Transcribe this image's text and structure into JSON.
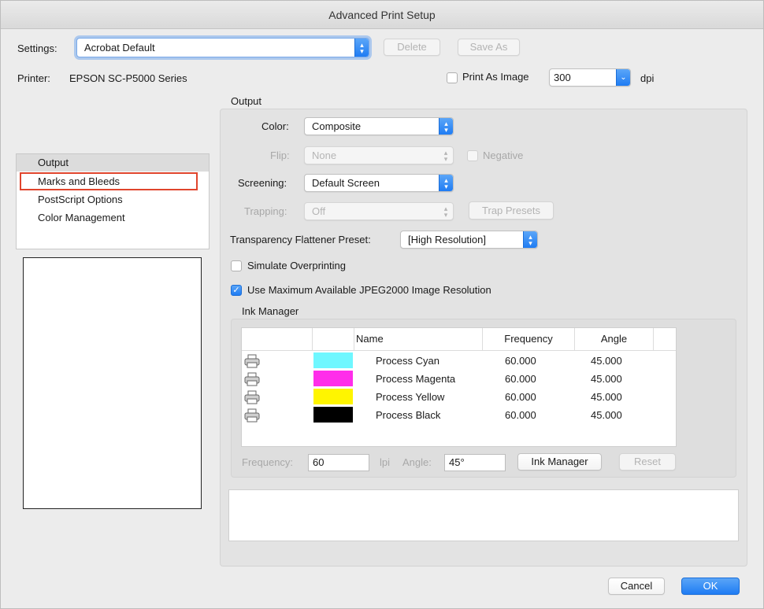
{
  "window": {
    "title": "Advanced Print Setup"
  },
  "settings": {
    "label": "Settings:",
    "value": "Acrobat Default",
    "delete_label": "Delete",
    "save_as_label": "Save As"
  },
  "printer": {
    "label": "Printer:",
    "name": "EPSON SC-P5000 Series",
    "print_as_image_label": "Print As Image",
    "print_as_image_checked": false,
    "dpi_value": "300",
    "dpi_unit": "dpi"
  },
  "sidebar": {
    "items": [
      {
        "label": "Output",
        "selected": true
      },
      {
        "label": "Marks and Bleeds",
        "highlighted": true
      },
      {
        "label": "PostScript Options"
      },
      {
        "label": "Color Management"
      }
    ]
  },
  "output": {
    "section_title": "Output",
    "color_label": "Color:",
    "color_value": "Composite",
    "flip_label": "Flip:",
    "flip_value": "None",
    "negative_label": "Negative",
    "negative_checked": false,
    "screening_label": "Screening:",
    "screening_value": "Default Screen",
    "trapping_label": "Trapping:",
    "trapping_value": "Off",
    "trap_presets_label": "Trap Presets",
    "flattener_label": "Transparency Flattener Preset:",
    "flattener_value": "[High Resolution]",
    "simulate_overprinting_label": "Simulate Overprinting",
    "simulate_overprinting_checked": false,
    "jpeg2000_label": "Use Maximum Available JPEG2000 Image Resolution",
    "jpeg2000_checked": true
  },
  "ink_manager": {
    "title": "Ink Manager",
    "columns": {
      "name": "Name",
      "frequency": "Frequency",
      "angle": "Angle"
    },
    "inks": [
      {
        "name": "Process Cyan",
        "frequency": "60.000",
        "angle": "45.000",
        "color": "#6ff7ff"
      },
      {
        "name": "Process Magenta",
        "frequency": "60.000",
        "angle": "45.000",
        "color": "#ff2eea"
      },
      {
        "name": "Process Yellow",
        "frequency": "60.000",
        "angle": "45.000",
        "color": "#fff500"
      },
      {
        "name": "Process Black",
        "frequency": "60.000",
        "angle": "45.000",
        "color": "#000000"
      }
    ],
    "frequency_label": "Frequency:",
    "frequency_value": "60",
    "lpi_label": "lpi",
    "angle_label": "Angle:",
    "angle_value": "45°",
    "ink_manager_button": "Ink Manager",
    "reset_button": "Reset"
  },
  "footer": {
    "cancel_label": "Cancel",
    "ok_label": "OK"
  },
  "colors": {
    "accent": "#1f7cf3",
    "highlight_border": "#e0452d"
  }
}
